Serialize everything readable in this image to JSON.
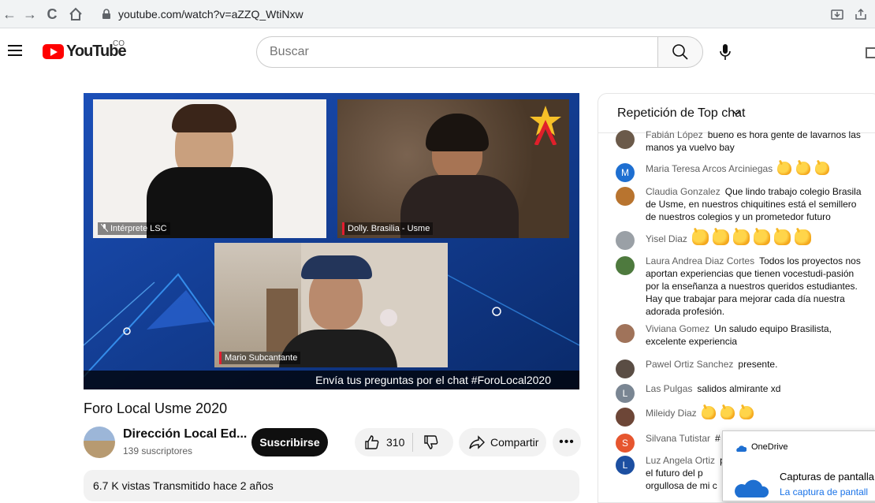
{
  "browser": {
    "url": "youtube.com/watch?v=aZZQ_WtiNxw"
  },
  "header": {
    "logo_text": "YouTube",
    "country_code": "CO",
    "search_placeholder": "Buscar"
  },
  "video": {
    "tiles": {
      "interpreter_label": "Intérprete LSC",
      "dolly_label": "Dolly. Brasilia - Usme",
      "mario_label": "Mario Subcantante"
    },
    "caption": "Envía tus preguntas por el chat #ForoLocal2020",
    "title": "Foro Local Usme 2020",
    "channel_name": "Dirección Local Ed...",
    "subscribers": "139 suscriptores",
    "subscribe_label": "Suscribirse",
    "likes": "310",
    "share_label": "Compartir",
    "views_line": "6.7 K vistas  Transmitido hace 2 años"
  },
  "chat": {
    "title": "Repetición de Top chat",
    "messages": [
      {
        "author": "Fabián López",
        "text": "bueno es hora gente de lavarnos las manos ya vuelvo bay",
        "avatar": "",
        "avatar_color": "#6b5a4a"
      },
      {
        "author": "Maria Teresa Arcos Arciniegas",
        "text": "",
        "avatar": "M",
        "avatar_color": "#1e6fd1",
        "claps": 3
      },
      {
        "author": "Claudia Gonzalez",
        "text": "Que lindo trabajo colegio Brasila de Usme, en nuestros chiquitines está el semillero de nuestros colegios y un prometedor futuro",
        "avatar": "",
        "avatar_color": "#b8742f"
      },
      {
        "author": "Yisel Diaz",
        "text": "",
        "avatar": "",
        "avatar_color": "#9aa0a6",
        "claps": 6
      },
      {
        "author": "Laura Andrea Diaz Cortes",
        "text": "Todos los proyectos nos aportan experiencias que tienen vocestudi-pasión por la enseñanza a nuestros queridos estudiantes. Hay que trabajar para mejorar cada día nuestra adorada profesión.",
        "avatar": "",
        "avatar_color": "#4e7a3e"
      },
      {
        "author": "Viviana Gomez",
        "text": "Un saludo equipo Brasilista, excelente experiencia",
        "avatar": "",
        "avatar_color": "#a0735a"
      },
      {
        "author": "Pawel Ortiz Sanchez",
        "text": "presente.",
        "avatar": "",
        "avatar_color": "#5a4d44"
      },
      {
        "author": "Las Pulgas",
        "text": "salidos almirante xd",
        "avatar": "L",
        "avatar_color": "#7a8693"
      },
      {
        "author": "Mileidy Diaz",
        "text": "",
        "avatar": "",
        "avatar_color": "#6d4637",
        "claps": 3
      },
      {
        "author": "Silvana Tutistar",
        "text": "#",
        "avatar": "S",
        "avatar_color": "#e6562f"
      },
      {
        "author": "Luz Angela Ortiz",
        "text": "por el futuro del p orgullosa de mi c",
        "avatar": "L",
        "avatar_color": "#1c4fa1"
      }
    ]
  },
  "toast": {
    "app": "OneDrive",
    "title": "Capturas de pantalla",
    "subtitle": "La captura de pantall"
  }
}
